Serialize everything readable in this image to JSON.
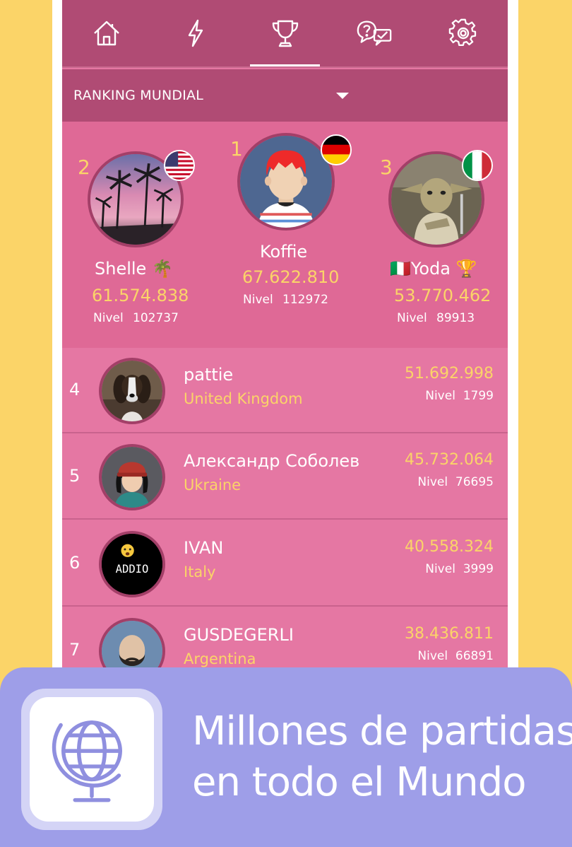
{
  "nav": {
    "tabs": [
      {
        "icon": "home-icon"
      },
      {
        "icon": "lightning-icon"
      },
      {
        "icon": "trophy-icon",
        "active": true
      },
      {
        "icon": "question-chat-icon"
      },
      {
        "icon": "settings-gear-icon"
      }
    ]
  },
  "ranking": {
    "dropdown_label": "RANKING MUNDIAL"
  },
  "podium": {
    "first": {
      "rank": "1",
      "name": "Koffie",
      "score": "67.622.810",
      "level_label": "Nivel",
      "level": "112972",
      "flag": "germany"
    },
    "second": {
      "rank": "2",
      "name": "Shelle 🌴",
      "score": "61.574.838",
      "level_label": "Nivel",
      "level": "102737",
      "flag": "usa"
    },
    "third": {
      "rank": "3",
      "name": "🇮🇹Yoda 🏆",
      "score": "53.770.462",
      "level_label": "Nivel",
      "level": "89913",
      "flag": "italy"
    }
  },
  "list": [
    {
      "rank": "4",
      "name": "pattie",
      "country": "United Kingdom",
      "score": "51.692.998",
      "level_label": "Nivel",
      "level": "1799"
    },
    {
      "rank": "5",
      "name": "Александр Соболев",
      "country": "Ukraine",
      "score": "45.732.064",
      "level_label": "Nivel",
      "level": "76695"
    },
    {
      "rank": "6",
      "name": "IVAN",
      "country": "Italy",
      "score": "40.558.324",
      "level_label": "Nivel",
      "level": "3999",
      "avatar_text": "ADDIO"
    },
    {
      "rank": "7",
      "name": "GUSDEGERLI",
      "country": "Argentina",
      "score": "38.436.811",
      "level_label": "Nivel",
      "level": "66891"
    }
  ],
  "banner": {
    "line1": "Millones de partidas",
    "line2": "en todo el Mundo",
    "icon": "globe-icon"
  },
  "colors": {
    "background": "#fbd468",
    "header": "#b04b74",
    "list_bg": "#e577a3",
    "accent_yellow": "#fbd468",
    "banner": "#9e9ee8"
  }
}
